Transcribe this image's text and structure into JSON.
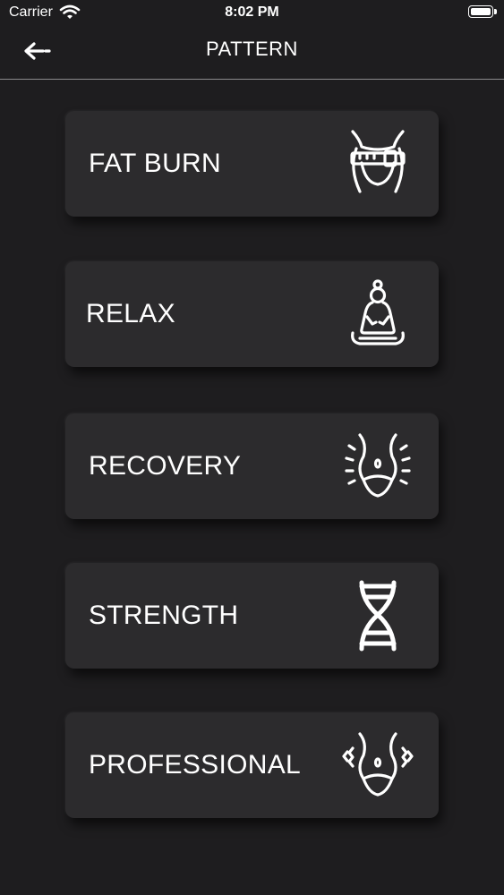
{
  "status": {
    "carrier": "Carrier",
    "time": "8:02 PM"
  },
  "header": {
    "title": "PATTERN"
  },
  "patterns": [
    {
      "label": "FAT BURN",
      "icon": "waist-measure-icon"
    },
    {
      "label": "RELAX",
      "icon": "meditation-icon"
    },
    {
      "label": "RECOVERY",
      "icon": "abdomen-recovery-icon"
    },
    {
      "label": "STRENGTH",
      "icon": "dna-icon"
    },
    {
      "label": "PROFESSIONAL",
      "icon": "abdomen-vibration-icon"
    }
  ]
}
